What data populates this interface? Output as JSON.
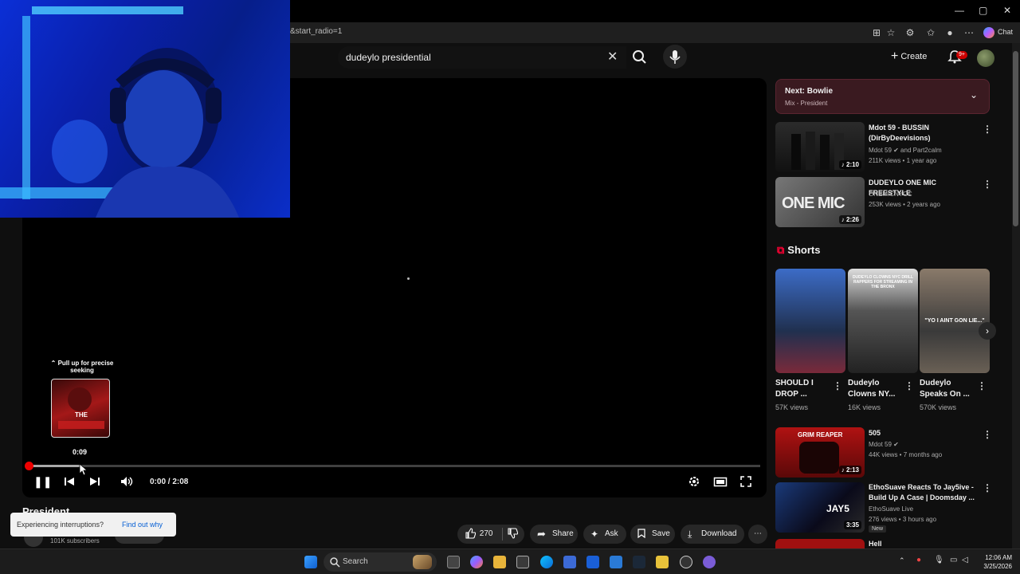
{
  "browser": {
    "url_tail": "&start_radio=1",
    "chat_label": "Chat"
  },
  "header": {
    "search_query": "dudeylo presidential",
    "create_label": "Create",
    "notif_badge": "9+"
  },
  "player": {
    "seek_hint": "⌃ Pull up for precise seeking",
    "seek_thumb_title": "THE",
    "seek_time": "0:09",
    "time_display": "0:00 / 2:08",
    "progress_hover_fraction": 0.07
  },
  "video": {
    "title": "President",
    "subscribers": "101K subscribers",
    "likes": "270",
    "share_label": "Share",
    "ask_label": "Ask",
    "save_label": "Save",
    "download_label": "Download"
  },
  "toast": {
    "text": "Experiencing interruptions?",
    "link": "Find out why"
  },
  "sidebar": {
    "next_title": "Next: Bowlie",
    "next_sub": "Mix - President",
    "videos": [
      {
        "title": "Mdot 59 - BUSSIN (DirByDeevisions)",
        "channel": "Mdot 59 ✔ and Part2calm",
        "meta": "211K views • 1 year ago",
        "duration": "♪ 2:10",
        "thumb_text": ""
      },
      {
        "title": "DUDEYLO ONE MIC FREESTYLE",
        "channel": "ONEMICNYCC",
        "meta": "253K views • 2 years ago",
        "duration": "♪ 2:26",
        "thumb_text": "ONE MIC"
      },
      {
        "title": "505",
        "channel": "Mdot 59 ✔",
        "meta": "44K views • 7 months ago",
        "duration": "♪ 2:13",
        "thumb_text": "GRIM REAPER"
      },
      {
        "title": "EthoSuave Reacts To Jay5ive - Build Up A Case | Doomsday ...",
        "channel": "EthoSuave Live",
        "meta": "276 views • 3 hours ago",
        "duration": "3:35",
        "badge": "New",
        "thumb_text": "JAY5"
      },
      {
        "title": "Hell",
        "channel": "",
        "meta": "",
        "duration": "",
        "thumb_text": ""
      }
    ],
    "shorts_heading": "Shorts",
    "shorts": [
      {
        "title": "SHOULD I DROP ...",
        "views": "57K views"
      },
      {
        "title": "Dudeylo Clowns NY...",
        "views": "16K views",
        "thumb_text": "DUDEYLO CLOWNS NYC DRILL RAPPERS FOR STREAMING IN THE BRONX"
      },
      {
        "title": "Dudeylo Speaks On ...",
        "views": "570K views",
        "thumb_text": "\"YO I AINT GON LIE...\""
      }
    ]
  },
  "taskbar": {
    "search_label": "Search",
    "time": "12:06 AM",
    "date": "3/25/2026"
  },
  "colors": {
    "accent_red": "#ee0000",
    "next_bg": "#3a1a20",
    "webcam_blue": "#0b2fd6"
  }
}
